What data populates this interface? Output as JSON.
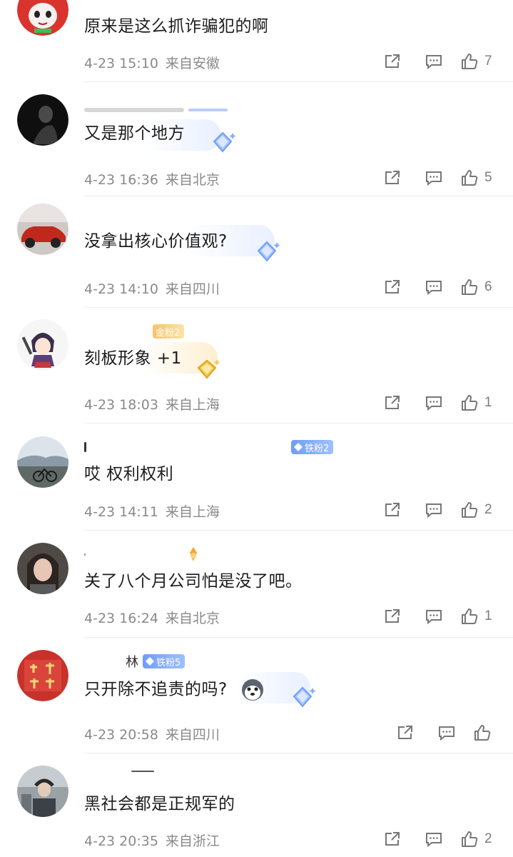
{
  "comments": [
    {
      "username": "",
      "fan_badge": "",
      "text": "原来是这么抓诈骗犯的啊",
      "time": "4-23 15:10",
      "location": "来自安徽",
      "likes": "7"
    },
    {
      "username": "",
      "fan_badge": "",
      "text": "又是那个地方",
      "time": "4-23 16:36",
      "location": "来自北京",
      "likes": "5"
    },
    {
      "username": "",
      "fan_badge": "",
      "text": "没拿出核心价值观?",
      "time": "4-23 14:10",
      "location": "来自四川",
      "likes": "6"
    },
    {
      "username": "",
      "fan_badge": "金粉2",
      "text": "刻板形象 +1",
      "time": "4-23 18:03",
      "location": "来自上海",
      "likes": "1"
    },
    {
      "username": "",
      "fan_badge": "铁粉2",
      "text": "哎 权利权利",
      "time": "4-23 14:11",
      "location": "来自上海",
      "likes": "2"
    },
    {
      "username": "",
      "fan_badge": "",
      "text": "关了八个月公司怕是没了吧。",
      "time": "4-23 16:24",
      "location": "来自北京",
      "likes": "1"
    },
    {
      "username": "林",
      "fan_badge": "铁粉5",
      "text": "只开除不追责的吗?",
      "time": "4-23 20:58",
      "location": "来自四川",
      "likes": ""
    },
    {
      "username": "",
      "fan_badge": "",
      "text": "黑社会都是正规军的",
      "time": "4-23 20:35",
      "location": "来自浙江",
      "likes": "2"
    }
  ],
  "colors": {
    "text": "#1c1c1c",
    "meta": "#8a8a8a",
    "badge_blue": "#6f9df5",
    "badge_gold": "#f6c36b",
    "divider": "#ececec"
  },
  "icons": {
    "share": "share-icon",
    "reply": "comment-icon",
    "like": "thumbs-up-icon"
  }
}
